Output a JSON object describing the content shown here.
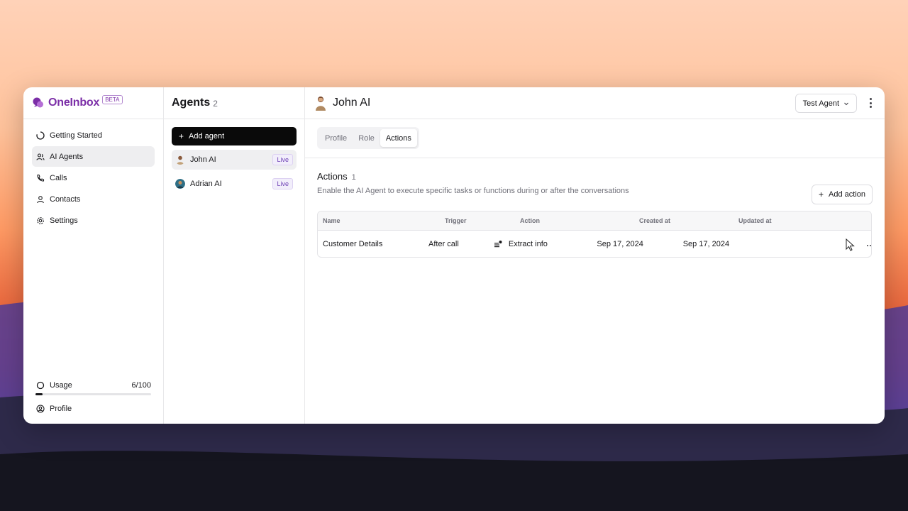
{
  "brand": {
    "name": "OneInbox",
    "badge": "BETA"
  },
  "sidebar": {
    "items": [
      {
        "label": "Getting Started",
        "icon": "loader-icon"
      },
      {
        "label": "AI Agents",
        "icon": "users-icon",
        "active": true
      },
      {
        "label": "Calls",
        "icon": "phone-icon"
      },
      {
        "label": "Contacts",
        "icon": "user-icon"
      },
      {
        "label": "Settings",
        "icon": "gear-icon"
      }
    ],
    "usage": {
      "label": "Usage",
      "value": "6/100",
      "fraction": 0.06
    },
    "profile": {
      "label": "Profile"
    }
  },
  "agents": {
    "title": "Agents",
    "count": "2",
    "add_label": "Add agent",
    "list": [
      {
        "name": "John AI",
        "status": "Live",
        "active": true
      },
      {
        "name": "Adrian AI",
        "status": "Live",
        "active": false
      }
    ]
  },
  "main": {
    "title": "John AI",
    "test_agent_label": "Test Agent",
    "tabs": [
      {
        "label": "Profile"
      },
      {
        "label": "Role"
      },
      {
        "label": "Actions",
        "active": true
      }
    ],
    "section": {
      "title": "Actions",
      "count": "1",
      "description": "Enable the AI Agent to execute specific tasks or functions during or after the conversations",
      "add_label": "Add action"
    },
    "table": {
      "headers": [
        "Name",
        "Trigger",
        "Action",
        "Created at",
        "Updated at"
      ],
      "rows": [
        {
          "name": "Customer Details",
          "trigger": "After call",
          "action": "Extract info",
          "created": "Sep 17, 2024",
          "updated": "Sep 17, 2024"
        }
      ]
    }
  },
  "colors": {
    "brand": "#7b2ea7",
    "primary_button": "#0a0a0a",
    "live_badge": "#6d3fb5"
  }
}
